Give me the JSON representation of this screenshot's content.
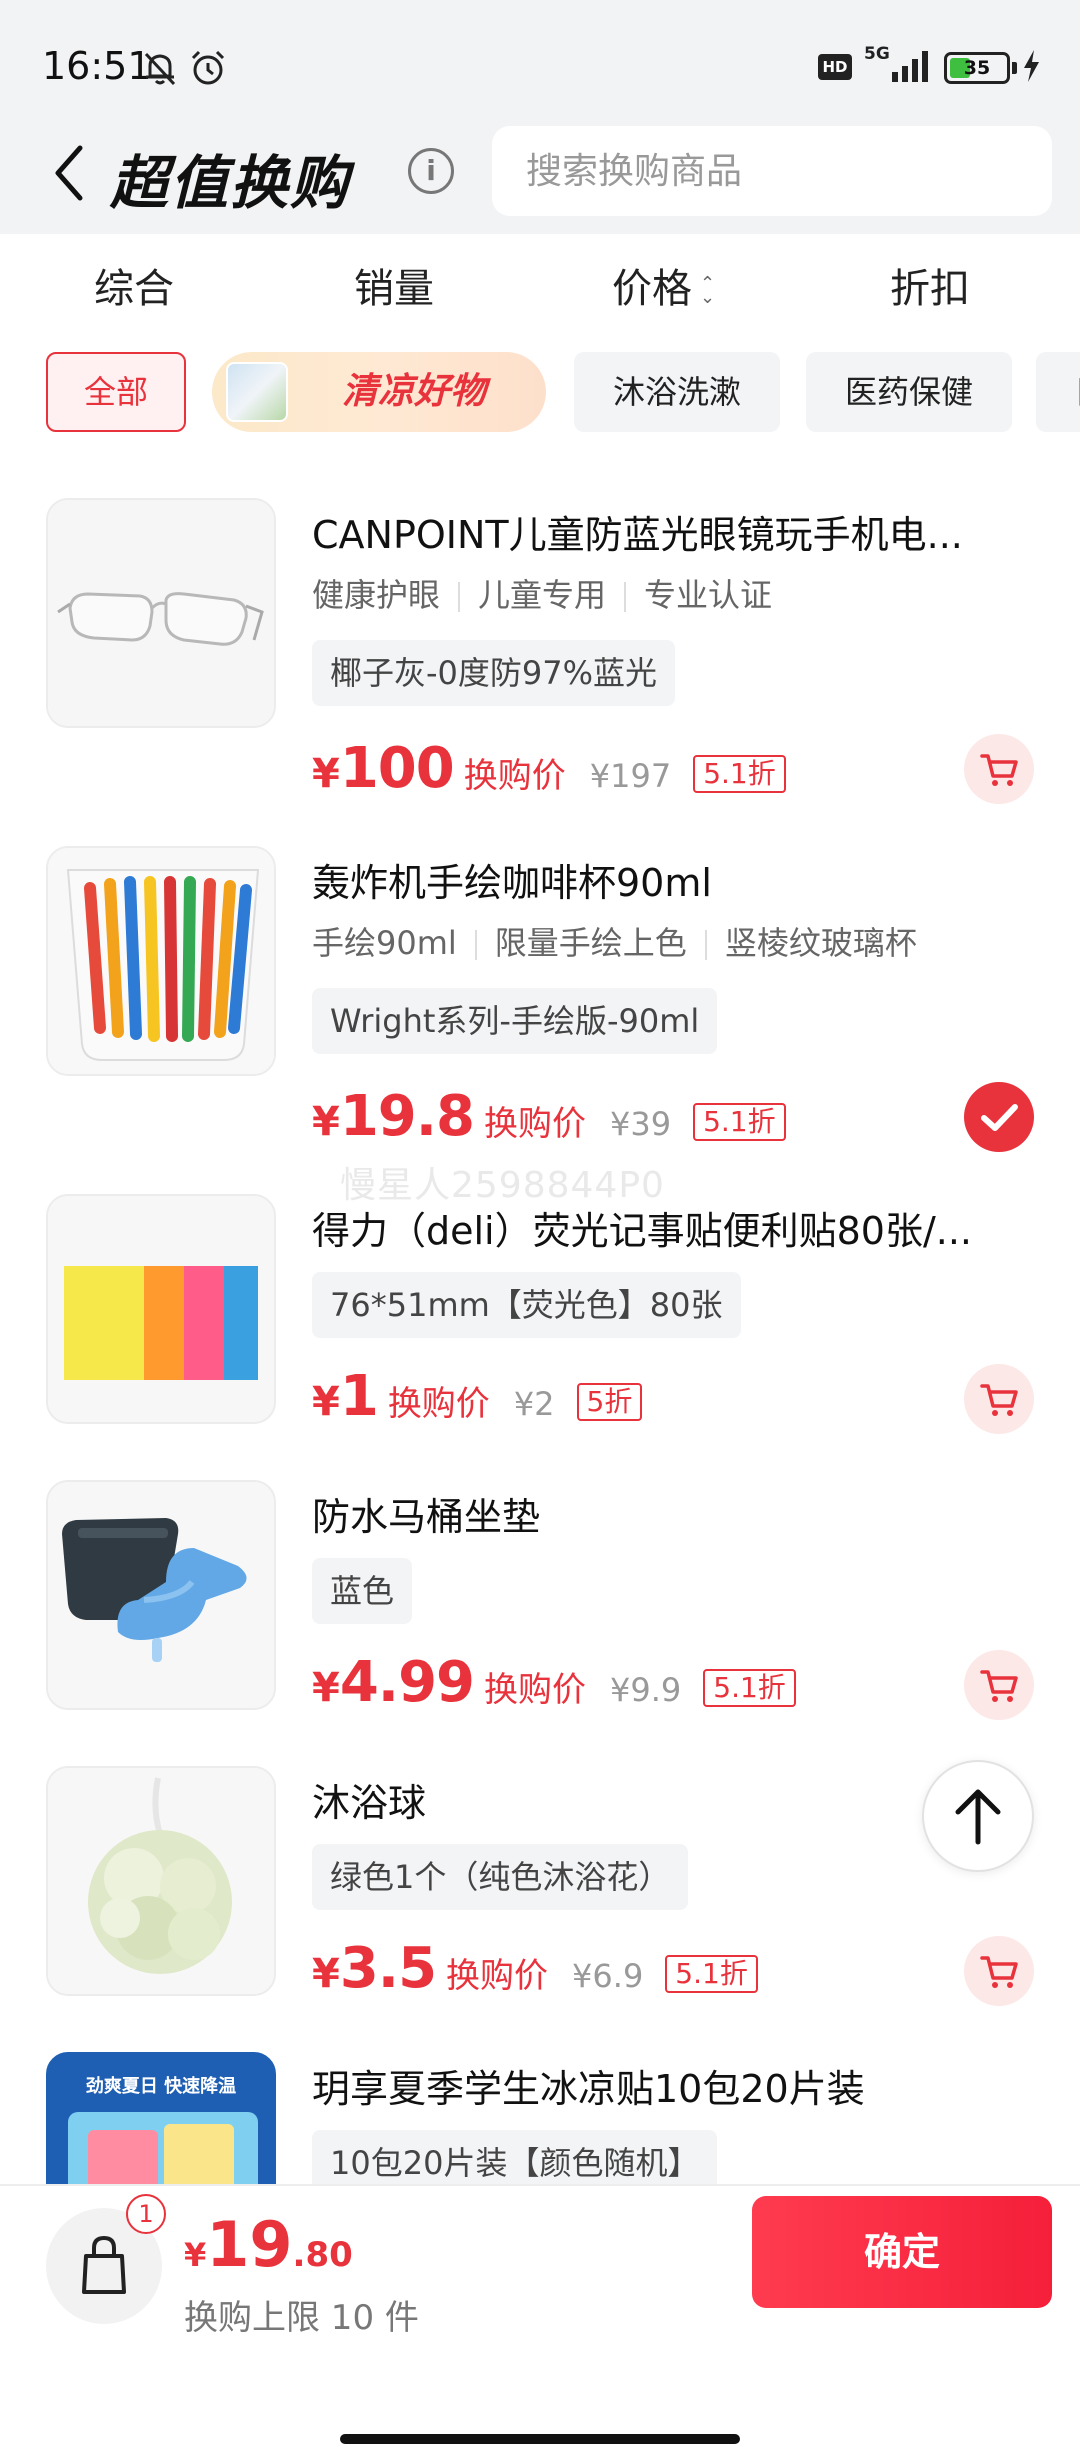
{
  "status_bar": {
    "time": "16:51",
    "hd": "HD",
    "network": "5G",
    "battery": "35"
  },
  "header": {
    "title": "超值换购",
    "search_placeholder": "搜索换购商品"
  },
  "sort_tabs": [
    "综合",
    "销量",
    "价格",
    "折扣"
  ],
  "categories": {
    "all": "全部",
    "featured": "清凉好物",
    "c3": "沐浴洗漱",
    "c4": "医药保健",
    "c5": "日"
  },
  "products": [
    {
      "title": "CANPOINT儿童防蓝光眼镜玩手机电...",
      "tags": [
        "健康护眼",
        "儿童专用",
        "专业认证"
      ],
      "spec": "椰子灰-0度防97%蓝光",
      "yen": "¥",
      "price": "100",
      "price_label": "换购价",
      "orig_price": "¥197",
      "discount": "5.1折",
      "selected": false
    },
    {
      "title": "轰炸机手绘咖啡杯90ml",
      "tags": [
        "手绘90ml",
        "限量手绘上色",
        "竖棱纹玻璃杯"
      ],
      "spec": "Wright系列-手绘版-90ml",
      "yen": "¥",
      "price": "19.8",
      "price_label": "换购价",
      "orig_price": "¥39",
      "discount": "5.1折",
      "selected": true
    },
    {
      "title": "得力（deli）荧光记事贴便利贴80张/...",
      "tags": [],
      "spec": "76*51mm【荧光色】80张",
      "yen": "¥",
      "price": "1",
      "price_label": "换购价",
      "orig_price": "¥2",
      "discount": "5折",
      "selected": false
    },
    {
      "title": "防水马桶坐垫",
      "tags": [],
      "spec": "蓝色",
      "yen": "¥",
      "price": "4.99",
      "price_label": "换购价",
      "orig_price": "¥9.9",
      "discount": "5.1折",
      "selected": false
    },
    {
      "title": "沐浴球",
      "tags": [],
      "spec": "绿色1个（纯色沐浴花）",
      "yen": "¥",
      "price": "3.5",
      "price_label": "换购价",
      "orig_price": "¥6.9",
      "discount": "5.1折",
      "selected": false
    },
    {
      "title": "玥享夏季学生冰凉贴10包20片装",
      "tags": [],
      "spec": "10包20片装【颜色随机】",
      "thumb_text": "劲爽夏日 快速降温"
    }
  ],
  "watermark": "慢星人2598844P0",
  "bottom": {
    "bag_count": "1",
    "yen": "¥",
    "total_int": "19",
    "total_dec": ".80",
    "limit": "换购上限 10 件",
    "confirm": "确定"
  },
  "colors": {
    "accent": "#e8323c",
    "bg_grey": "#f2f3f5"
  }
}
